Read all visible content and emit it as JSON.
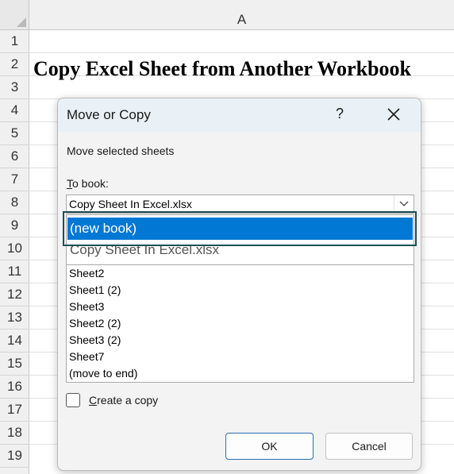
{
  "sheet": {
    "column_label": "A",
    "rows": [
      "1",
      "2",
      "3",
      "4",
      "5",
      "6",
      "7",
      "8",
      "9",
      "10",
      "11",
      "12",
      "13",
      "14",
      "15",
      "16",
      "17",
      "18",
      "19"
    ],
    "title": "Copy Excel Sheet from Another Workbook"
  },
  "dialog": {
    "title": "Move or Copy",
    "help_label": "?",
    "close_label": "✕",
    "description": "Move selected sheets",
    "to_book_accel": "T",
    "to_book_rest": "o book:",
    "to_book_value": "Copy Sheet In Excel.xlsx",
    "dropdown_options": [
      "(new book)",
      "Copy Sheet In Excel.xlsx"
    ],
    "sheets": [
      "Sheet2",
      "Sheet1 (2)",
      "Sheet3",
      "Sheet2 (2)",
      "Sheet3 (2)",
      "Sheet7",
      "(move to end)"
    ],
    "create_copy_accel": "C",
    "create_copy_rest": "reate a copy",
    "ok_label": "OK",
    "cancel_label": "Cancel"
  },
  "colors": {
    "accent": "#0078d4",
    "focus_border": "#1b4f55",
    "titlebar": "#e9f1f6"
  }
}
